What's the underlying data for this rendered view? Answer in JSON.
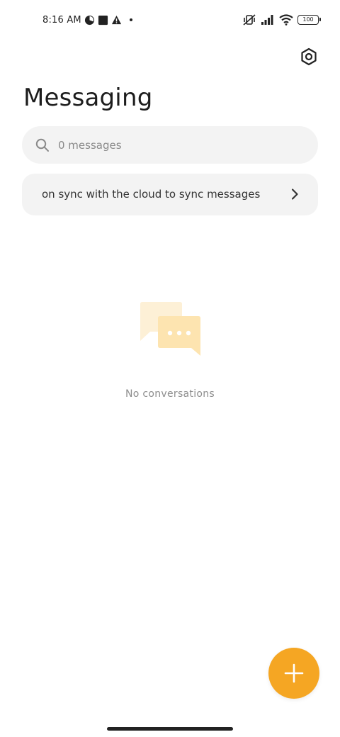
{
  "status_bar": {
    "time": "8:16 AM",
    "battery": "100",
    "icons_left": [
      "cloud-icon",
      "dashboard-icon",
      "pie-icon",
      "square-icon",
      "warning-icon",
      "dot-icon"
    ],
    "icons_right": [
      "vibrate-off-icon",
      "signal-icon",
      "wifi-icon",
      "battery-icon"
    ]
  },
  "header": {
    "title": "Messaging",
    "settings_icon": "settings-hex-icon"
  },
  "search": {
    "placeholder": "0 messages",
    "value": ""
  },
  "sync_banner": {
    "text": "on sync with the cloud to sync messages"
  },
  "empty_state": {
    "text": "No conversations"
  },
  "fab": {
    "icon": "plus-icon"
  },
  "colors": {
    "accent": "#f5a623",
    "surface": "#f3f3f3",
    "illustration_light": "#fdf0d6",
    "illustration_mid": "#fde4b0"
  }
}
